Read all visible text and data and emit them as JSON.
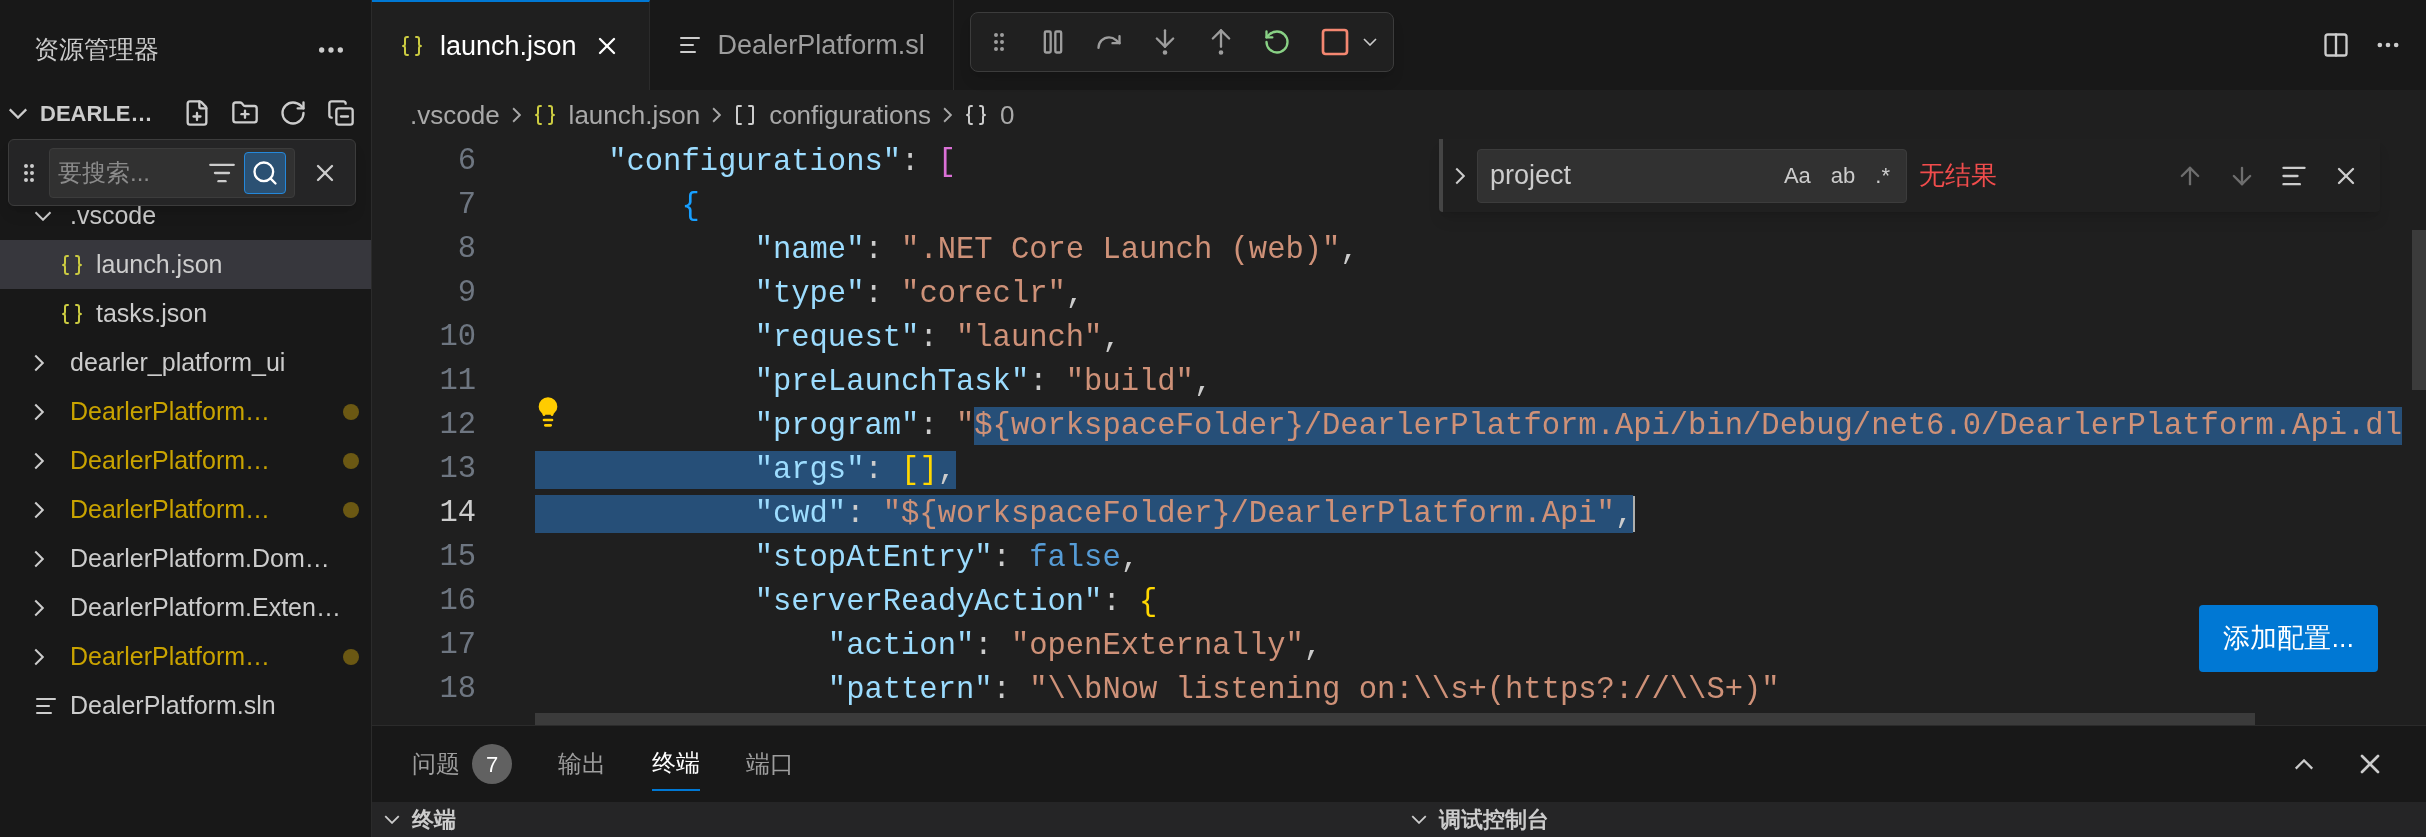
{
  "sidebar": {
    "title": "资源管理器",
    "section": {
      "title": "DEARLE…",
      "expanded": true
    },
    "filter": {
      "placeholder": "要搜索...",
      "fuzzy": true
    },
    "tree": [
      {
        "label": ".vscode",
        "kind": "folder",
        "expanded": true,
        "modified": false,
        "selected": false,
        "children": [
          {
            "label": "launch.json",
            "kind": "json",
            "modified": false,
            "selected": true
          },
          {
            "label": "tasks.json",
            "kind": "json",
            "modified": false,
            "selected": false
          }
        ]
      },
      {
        "label": "dearler_platform_ui",
        "kind": "folder",
        "expanded": false,
        "modified": false,
        "selected": false
      },
      {
        "label": "DearlerPlatform…",
        "kind": "folder",
        "expanded": false,
        "modified": true,
        "selected": false
      },
      {
        "label": "DearlerPlatform…",
        "kind": "folder",
        "expanded": false,
        "modified": true,
        "selected": false
      },
      {
        "label": "DearlerPlatform…",
        "kind": "folder",
        "expanded": false,
        "modified": true,
        "selected": false
      },
      {
        "label": "DearlerPlatform.Dom…",
        "kind": "folder",
        "expanded": false,
        "modified": false,
        "selected": false
      },
      {
        "label": "DearlerPlatform.Exten…",
        "kind": "folder",
        "expanded": false,
        "modified": false,
        "selected": false
      },
      {
        "label": "DearlerPlatform…",
        "kind": "folder",
        "expanded": false,
        "modified": true,
        "selected": false
      },
      {
        "label": "DealerPlatform.sln",
        "kind": "text",
        "modified": false,
        "selected": false
      }
    ]
  },
  "tabs": [
    {
      "label": "launch.json",
      "kind": "json",
      "selected": true
    },
    {
      "label": "DealerPlatform.sl",
      "kind": "text",
      "selected": false
    }
  ],
  "breadcrumbs": [
    {
      "label": ".vscode",
      "kind": "folder"
    },
    {
      "label": "launch.json",
      "kind": "json"
    },
    {
      "label": "configurations",
      "kind": "array"
    },
    {
      "label": "0",
      "kind": "object"
    }
  ],
  "find": {
    "value": "project",
    "toggles": [
      {
        "label": "Aa",
        "on": false
      },
      {
        "label": "ab",
        "on": false
      },
      {
        "label": ".*",
        "on": false
      }
    ],
    "result": "无结果"
  },
  "editor": {
    "lines": [
      {
        "number": "6",
        "current": false,
        "lightbulb": false,
        "tokens": [
          {
            "t": "    \"configurations\"",
            "kind": "key",
            "selected": false
          },
          {
            "t": ": ",
            "kind": "punct",
            "selected": false
          },
          {
            "t": "[",
            "kind": "bracket1",
            "selected": false
          }
        ]
      },
      {
        "number": "7",
        "current": false,
        "lightbulb": false,
        "tokens": [
          {
            "t": "        {",
            "kind": "bracket2",
            "selected": false
          }
        ]
      },
      {
        "number": "8",
        "current": false,
        "lightbulb": false,
        "tokens": [
          {
            "t": "            \"name\"",
            "kind": "key",
            "selected": false
          },
          {
            "t": ": ",
            "kind": "punct",
            "selected": false
          },
          {
            "t": "\".NET Core Launch (web)\"",
            "kind": "string",
            "selected": false
          },
          {
            "t": ",",
            "kind": "punct",
            "selected": false
          }
        ]
      },
      {
        "number": "9",
        "current": false,
        "lightbulb": false,
        "tokens": [
          {
            "t": "            \"type\"",
            "kind": "key",
            "selected": false
          },
          {
            "t": ": ",
            "kind": "punct",
            "selected": false
          },
          {
            "t": "\"coreclr\"",
            "kind": "string",
            "selected": false
          },
          {
            "t": ",",
            "kind": "punct",
            "selected": false
          }
        ]
      },
      {
        "number": "10",
        "current": false,
        "lightbulb": false,
        "tokens": [
          {
            "t": "            \"request\"",
            "kind": "key",
            "selected": false
          },
          {
            "t": ": ",
            "kind": "punct",
            "selected": false
          },
          {
            "t": "\"launch\"",
            "kind": "string",
            "selected": false
          },
          {
            "t": ",",
            "kind": "punct",
            "selected": false
          }
        ]
      },
      {
        "number": "11",
        "current": false,
        "lightbulb": false,
        "tokens": [
          {
            "t": "            \"preLaunchTask\"",
            "kind": "key",
            "selected": false
          },
          {
            "t": ": ",
            "kind": "punct",
            "selected": false
          },
          {
            "t": "\"build\"",
            "kind": "string",
            "selected": false
          },
          {
            "t": ",",
            "kind": "punct",
            "selected": false
          }
        ]
      },
      {
        "number": "12",
        "current": false,
        "lightbulb": true,
        "tokens": [
          {
            "t": "            \"program\"",
            "kind": "key",
            "selected": false
          },
          {
            "t": ": ",
            "kind": "punct",
            "selected": false
          },
          {
            "t": "\"",
            "kind": "string",
            "selected": false
          },
          {
            "t": "${workspaceFolder}/DearlerPlatform.Api/bin/Debug/net6.0/DearlerPlatform.Api.dl",
            "kind": "string",
            "selected": true
          }
        ]
      },
      {
        "number": "13",
        "current": false,
        "lightbulb": false,
        "tokens": [
          {
            "t": "            \"args\"",
            "kind": "key",
            "selected": true
          },
          {
            "t": ": ",
            "kind": "punct",
            "selected": true
          },
          {
            "t": "[]",
            "kind": "bracket3",
            "selected": true
          },
          {
            "t": ",",
            "kind": "punct",
            "selected": true
          }
        ]
      },
      {
        "number": "14",
        "current": true,
        "lightbulb": false,
        "tokens": [
          {
            "t": "            \"cwd\"",
            "kind": "key",
            "selected": true
          },
          {
            "t": ": ",
            "kind": "punct",
            "selected": true
          },
          {
            "t": "\"${workspaceFolder}/DearlerPlatform.Api\"",
            "kind": "string",
            "selected": true
          },
          {
            "t": ",",
            "kind": "punct",
            "selected": true
          }
        ]
      },
      {
        "number": "15",
        "current": false,
        "lightbulb": false,
        "tokens": [
          {
            "t": "            \"stopAtEntry\"",
            "kind": "key",
            "selected": false
          },
          {
            "t": ": ",
            "kind": "punct",
            "selected": false
          },
          {
            "t": "false",
            "kind": "bool",
            "selected": false
          },
          {
            "t": ",",
            "kind": "punct",
            "selected": false
          }
        ]
      },
      {
        "number": "16",
        "current": false,
        "lightbulb": false,
        "tokens": [
          {
            "t": "            \"serverReadyAction\"",
            "kind": "key",
            "selected": false
          },
          {
            "t": ": ",
            "kind": "punct",
            "selected": false
          },
          {
            "t": "{",
            "kind": "bracket3",
            "selected": false
          }
        ]
      },
      {
        "number": "17",
        "current": false,
        "lightbulb": false,
        "tokens": [
          {
            "t": "                \"action\"",
            "kind": "key",
            "selected": false
          },
          {
            "t": ": ",
            "kind": "punct",
            "selected": false
          },
          {
            "t": "\"openExternally\"",
            "kind": "string",
            "selected": false
          },
          {
            "t": ",",
            "kind": "punct",
            "selected": false
          }
        ]
      },
      {
        "number": "18",
        "current": false,
        "lightbulb": false,
        "tokens": [
          {
            "t": "                \"pattern\"",
            "kind": "key",
            "selected": false
          },
          {
            "t": ": ",
            "kind": "punct",
            "selected": false
          },
          {
            "t": "\"\\\\bNow listening on:\\\\s+(https?://\\\\S+)\"",
            "kind": "string",
            "selected": false
          }
        ]
      }
    ]
  },
  "action_button": "添加配置...",
  "panel": {
    "tabs": [
      {
        "label": "问题",
        "badge": "7",
        "selected": false
      },
      {
        "label": "输出",
        "selected": false
      },
      {
        "label": "终端",
        "selected": true
      },
      {
        "label": "端口",
        "selected": false
      }
    ],
    "sections": [
      {
        "title": "终端",
        "expanded": true
      },
      {
        "title": "调试控制台",
        "expanded": true
      }
    ]
  }
}
